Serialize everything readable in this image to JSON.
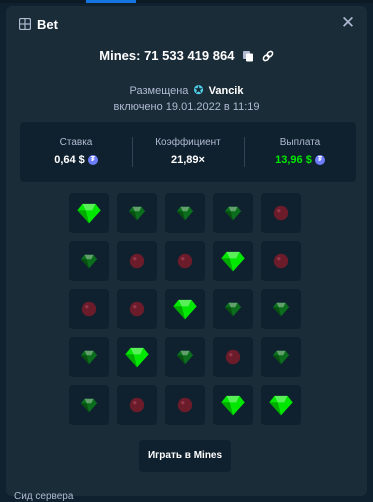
{
  "modal": {
    "title": "Bet",
    "title_icon": "ticket-icon",
    "close_glyph": "✕",
    "close_icon": "close-icon"
  },
  "bet": {
    "game_id_text": "Mines: 71 533 419 864",
    "copy_icon": "copy-icon",
    "link_icon": "link-icon",
    "placed_label": "Размещена",
    "user_star_glyph": "✪",
    "user": "Vancik",
    "datetime": "включено 19.01.2022 в 11:19"
  },
  "stats": {
    "stake_label": "Ставка",
    "stake_value": "0,64 $",
    "multiplier_label": "Коэффициент",
    "multiplier_value": "21,89×",
    "payout_label": "Выплата",
    "payout_value": "13,96 $",
    "coin_glyph": "₮",
    "coin_icon": "tether-coin-icon",
    "payout_color": "#00e701"
  },
  "board": {
    "rows": [
      [
        "gem-picked",
        "gem",
        "gem",
        "gem",
        "mine"
      ],
      [
        "gem",
        "mine",
        "mine",
        "gem-picked",
        "mine"
      ],
      [
        "mine",
        "mine",
        "gem-picked",
        "gem",
        "gem"
      ],
      [
        "gem",
        "gem-picked",
        "gem",
        "mine",
        "gem"
      ],
      [
        "gem",
        "mine",
        "mine",
        "gem-picked",
        "gem-picked"
      ]
    ],
    "colors": {
      "gem_bright": "#00e701",
      "gem_dim": "#0b6e1d",
      "mine_dim": "#6b1b2a"
    }
  },
  "actions": {
    "play_label": "Играть в Mines"
  },
  "footer": {
    "seed_text": "Сид сервера"
  }
}
